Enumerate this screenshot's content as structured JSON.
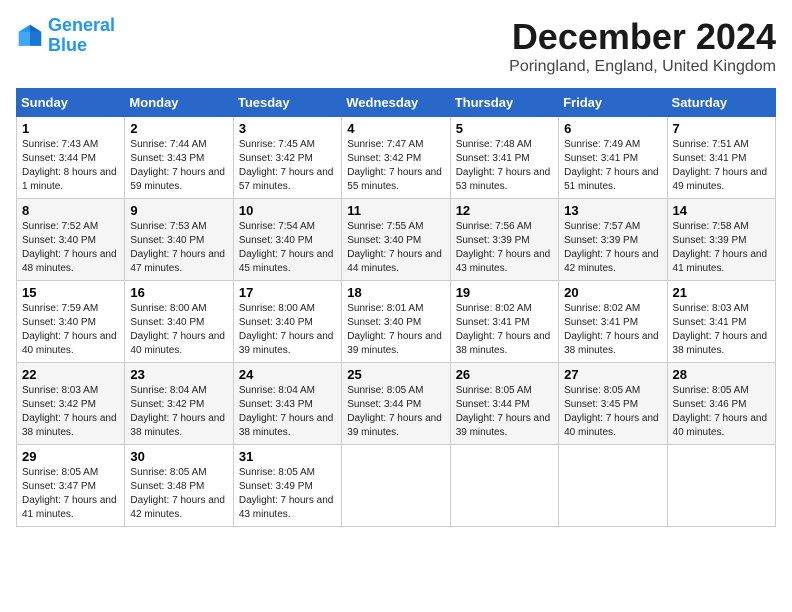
{
  "logo": {
    "line1": "General",
    "line2": "Blue"
  },
  "title": "December 2024",
  "subtitle": "Poringland, England, United Kingdom",
  "days_header": [
    "Sunday",
    "Monday",
    "Tuesday",
    "Wednesday",
    "Thursday",
    "Friday",
    "Saturday"
  ],
  "weeks": [
    [
      {
        "day": "1",
        "sunrise": "7:43 AM",
        "sunset": "3:44 PM",
        "daylight": "8 hours and 1 minute."
      },
      {
        "day": "2",
        "sunrise": "7:44 AM",
        "sunset": "3:43 PM",
        "daylight": "7 hours and 59 minutes."
      },
      {
        "day": "3",
        "sunrise": "7:45 AM",
        "sunset": "3:42 PM",
        "daylight": "7 hours and 57 minutes."
      },
      {
        "day": "4",
        "sunrise": "7:47 AM",
        "sunset": "3:42 PM",
        "daylight": "7 hours and 55 minutes."
      },
      {
        "day": "5",
        "sunrise": "7:48 AM",
        "sunset": "3:41 PM",
        "daylight": "7 hours and 53 minutes."
      },
      {
        "day": "6",
        "sunrise": "7:49 AM",
        "sunset": "3:41 PM",
        "daylight": "7 hours and 51 minutes."
      },
      {
        "day": "7",
        "sunrise": "7:51 AM",
        "sunset": "3:41 PM",
        "daylight": "7 hours and 49 minutes."
      }
    ],
    [
      {
        "day": "8",
        "sunrise": "7:52 AM",
        "sunset": "3:40 PM",
        "daylight": "7 hours and 48 minutes."
      },
      {
        "day": "9",
        "sunrise": "7:53 AM",
        "sunset": "3:40 PM",
        "daylight": "7 hours and 47 minutes."
      },
      {
        "day": "10",
        "sunrise": "7:54 AM",
        "sunset": "3:40 PM",
        "daylight": "7 hours and 45 minutes."
      },
      {
        "day": "11",
        "sunrise": "7:55 AM",
        "sunset": "3:40 PM",
        "daylight": "7 hours and 44 minutes."
      },
      {
        "day": "12",
        "sunrise": "7:56 AM",
        "sunset": "3:39 PM",
        "daylight": "7 hours and 43 minutes."
      },
      {
        "day": "13",
        "sunrise": "7:57 AM",
        "sunset": "3:39 PM",
        "daylight": "7 hours and 42 minutes."
      },
      {
        "day": "14",
        "sunrise": "7:58 AM",
        "sunset": "3:39 PM",
        "daylight": "7 hours and 41 minutes."
      }
    ],
    [
      {
        "day": "15",
        "sunrise": "7:59 AM",
        "sunset": "3:40 PM",
        "daylight": "7 hours and 40 minutes."
      },
      {
        "day": "16",
        "sunrise": "8:00 AM",
        "sunset": "3:40 PM",
        "daylight": "7 hours and 40 minutes."
      },
      {
        "day": "17",
        "sunrise": "8:00 AM",
        "sunset": "3:40 PM",
        "daylight": "7 hours and 39 minutes."
      },
      {
        "day": "18",
        "sunrise": "8:01 AM",
        "sunset": "3:40 PM",
        "daylight": "7 hours and 39 minutes."
      },
      {
        "day": "19",
        "sunrise": "8:02 AM",
        "sunset": "3:41 PM",
        "daylight": "7 hours and 38 minutes."
      },
      {
        "day": "20",
        "sunrise": "8:02 AM",
        "sunset": "3:41 PM",
        "daylight": "7 hours and 38 minutes."
      },
      {
        "day": "21",
        "sunrise": "8:03 AM",
        "sunset": "3:41 PM",
        "daylight": "7 hours and 38 minutes."
      }
    ],
    [
      {
        "day": "22",
        "sunrise": "8:03 AM",
        "sunset": "3:42 PM",
        "daylight": "7 hours and 38 minutes."
      },
      {
        "day": "23",
        "sunrise": "8:04 AM",
        "sunset": "3:42 PM",
        "daylight": "7 hours and 38 minutes."
      },
      {
        "day": "24",
        "sunrise": "8:04 AM",
        "sunset": "3:43 PM",
        "daylight": "7 hours and 38 minutes."
      },
      {
        "day": "25",
        "sunrise": "8:05 AM",
        "sunset": "3:44 PM",
        "daylight": "7 hours and 39 minutes."
      },
      {
        "day": "26",
        "sunrise": "8:05 AM",
        "sunset": "3:44 PM",
        "daylight": "7 hours and 39 minutes."
      },
      {
        "day": "27",
        "sunrise": "8:05 AM",
        "sunset": "3:45 PM",
        "daylight": "7 hours and 40 minutes."
      },
      {
        "day": "28",
        "sunrise": "8:05 AM",
        "sunset": "3:46 PM",
        "daylight": "7 hours and 40 minutes."
      }
    ],
    [
      {
        "day": "29",
        "sunrise": "8:05 AM",
        "sunset": "3:47 PM",
        "daylight": "7 hours and 41 minutes."
      },
      {
        "day": "30",
        "sunrise": "8:05 AM",
        "sunset": "3:48 PM",
        "daylight": "7 hours and 42 minutes."
      },
      {
        "day": "31",
        "sunrise": "8:05 AM",
        "sunset": "3:49 PM",
        "daylight": "7 hours and 43 minutes."
      },
      null,
      null,
      null,
      null
    ]
  ]
}
